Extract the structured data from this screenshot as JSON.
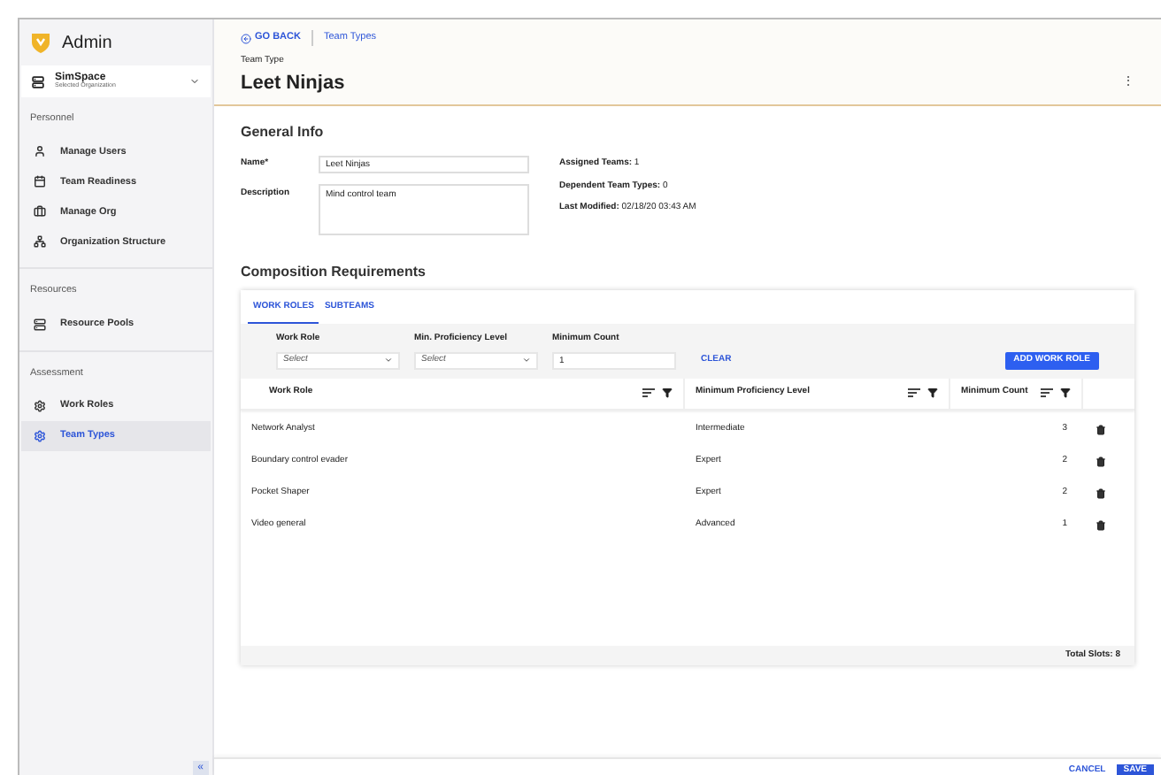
{
  "sidebar": {
    "title": "Admin",
    "org": {
      "name": "SimSpace",
      "caption": "Selected Organization"
    },
    "sections": [
      {
        "heading": "Personnel",
        "items": [
          {
            "label": "Manage Users",
            "kind": "user",
            "selected": false
          },
          {
            "label": "Team Readiness",
            "kind": "calendar",
            "selected": false
          },
          {
            "label": "Manage Org",
            "kind": "briefcase",
            "selected": false
          },
          {
            "label": "Organization Structure",
            "kind": "tree",
            "selected": false
          }
        ]
      },
      {
        "heading": "Resources",
        "items": [
          {
            "label": "Resource Pools",
            "kind": "server",
            "selected": false
          }
        ]
      },
      {
        "heading": "Assessment",
        "items": [
          {
            "label": "Work Roles",
            "kind": "gear",
            "selected": false
          },
          {
            "label": "Team Types",
            "kind": "gear",
            "selected": true
          }
        ]
      }
    ],
    "collapse": "«"
  },
  "header": {
    "back": "GO BACK",
    "breadcrumb": "Team Types",
    "caption": "Team Type",
    "title": "Leet Ninjas",
    "menu": "⋮"
  },
  "general": {
    "heading": "General Info",
    "name_label": "Name*",
    "name_value": "Leet Ninjas",
    "description_label": "Description",
    "description_value": "Mind control team",
    "stats": [
      {
        "label": "Assigned Teams:",
        "value": "1"
      },
      {
        "label": "Dependent Team Types:",
        "value": "0"
      },
      {
        "label": "Last Modified:",
        "value": "02/18/20 03:43 AM"
      }
    ]
  },
  "composition": {
    "heading": "Composition Requirements",
    "tabs": [
      {
        "label": "WORK ROLES",
        "selected": true
      },
      {
        "label": "SUBTEAMS",
        "selected": false
      }
    ],
    "filters": [
      {
        "label": "Work Role",
        "kind": "select",
        "placeholder": "Select"
      },
      {
        "label": "Min. Proficiency Level",
        "kind": "select",
        "placeholder": "Select"
      },
      {
        "label": "Minimum Count",
        "kind": "input",
        "value": "1"
      }
    ],
    "clear": "CLEAR",
    "add": "ADD WORK ROLE",
    "columns": [
      "Work Role",
      "Minimum Proficiency Level",
      "Minimum Count"
    ],
    "rows": [
      {
        "role": "Network Analyst",
        "level": "Intermediate",
        "count": "3"
      },
      {
        "role": "Boundary control evader",
        "level": "Expert",
        "count": "2"
      },
      {
        "role": "Pocket Shaper",
        "level": "Expert",
        "count": "2"
      },
      {
        "role": "Video general",
        "level": "Advanced",
        "count": "1"
      }
    ],
    "total": "Total Slots: 8"
  },
  "footer": {
    "cancel": "CANCEL",
    "save": "SAVE"
  }
}
